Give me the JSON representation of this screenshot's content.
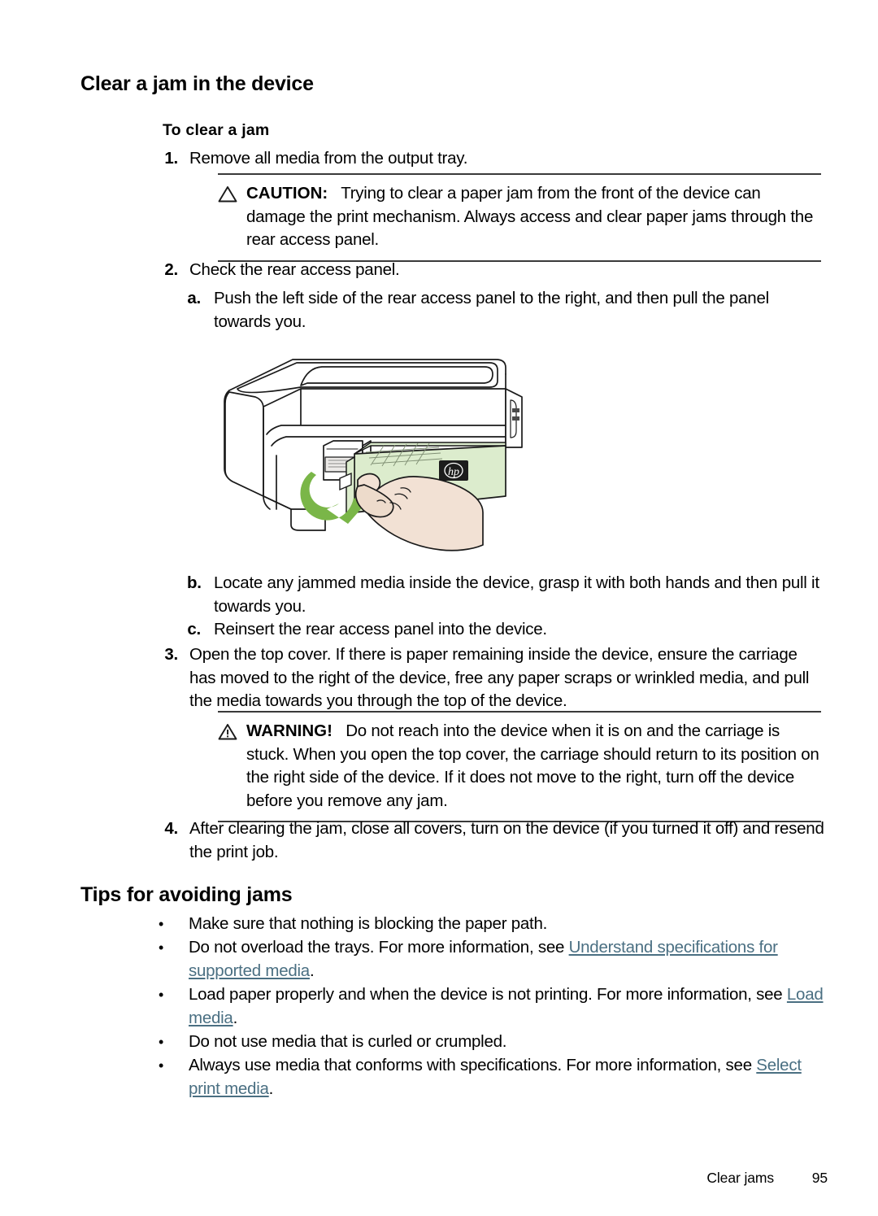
{
  "page": {
    "heading": "Clear a jam in the device",
    "footer_label": "Clear jams",
    "footer_page": "95"
  },
  "procedure": {
    "title": "To clear a jam",
    "steps": [
      {
        "marker": "1.",
        "text": "Remove all media from the output tray."
      },
      {
        "marker": "2.",
        "text": "Check the rear access panel."
      },
      {
        "marker": "a.",
        "text": "Push the left side of the rear access panel to the right, and then pull the panel towards you."
      },
      {
        "marker": "b.",
        "text": "Locate any jammed media inside the device, grasp it with both hands and then pull it towards you."
      },
      {
        "marker": "c.",
        "text": "Reinsert the rear access panel into the device."
      },
      {
        "marker": "3.",
        "text": "Open the top cover. If there is paper remaining inside the device, ensure the carriage has moved to the right of the device, free any paper scraps or wrinkled media, and pull the media towards you through the top of the device."
      },
      {
        "marker": "4.",
        "text": "After clearing the jam, close all covers, turn on the device (if you turned it off) and resend the print job."
      }
    ]
  },
  "caution": {
    "icon": "warning-triangle-icon",
    "label": "CAUTION:",
    "text": "Trying to clear a paper jam from the front of the device can damage the print mechanism. Always access and clear paper jams through the rear access panel."
  },
  "warning": {
    "icon": "warning-triangle-exclamation-icon",
    "label": "WARNING!",
    "text": "Do not reach into the device when it is on and the carriage is stuck. When you open the top cover, the carriage should return to its position on the right side of the device. If it does not move to the right, turn off the device before you remove any jam."
  },
  "tips": {
    "heading": "Tips for avoiding jams",
    "bullet_glyph": "•",
    "items": [
      {
        "pre": "Make sure that nothing is blocking the paper path.",
        "link": "",
        "post": ""
      },
      {
        "pre": "Do not overload the trays. For more information, see ",
        "link": "Understand specifications for supported media",
        "post": "."
      },
      {
        "pre": "Load paper properly and when the device is not printing. For more information, see ",
        "link": "Load media",
        "post": "."
      },
      {
        "pre": "Do not use media that is curled or crumpled.",
        "link": "",
        "post": ""
      },
      {
        "pre": "Always use media that conforms with specifications. For more information, see ",
        "link": "Select print media",
        "post": "."
      }
    ]
  },
  "illustration": {
    "alt": "HP printer with rear access panel being pulled out by a hand",
    "brand_mark": "hp",
    "panel_color": "#dceccd",
    "arrow_color": "#7ab648",
    "outline_color": "#1a1a1a",
    "hand_color": "#f0ddd0"
  },
  "colors": {
    "link": "#4a6f82",
    "rule": "#3a3a3a",
    "text": "#000000"
  }
}
